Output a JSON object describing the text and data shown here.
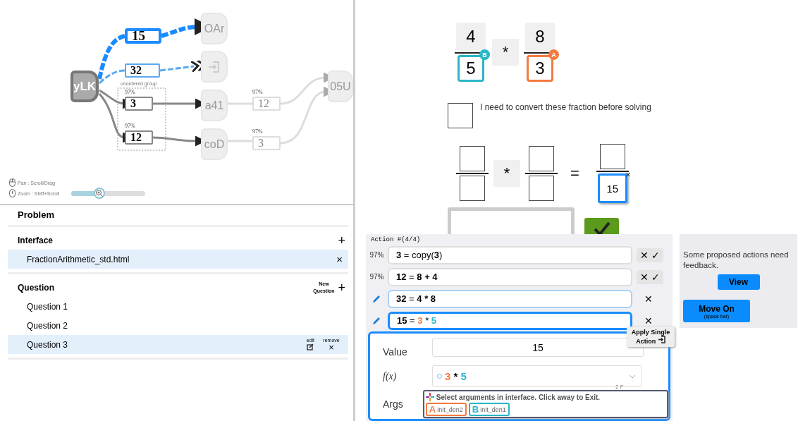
{
  "graph": {
    "nodes": [
      {
        "label": "yLK",
        "kind": "source"
      },
      {
        "label": "OAr",
        "kind": "faded"
      },
      {
        "kind": "icon"
      },
      {
        "label": "a41",
        "kind": "faded"
      },
      {
        "label": "coD",
        "kind": "faded"
      },
      {
        "label": "05U",
        "kind": "faded"
      }
    ],
    "values": [
      {
        "value": "15",
        "selected": true,
        "proposed": true,
        "faded": false
      },
      {
        "value": "32",
        "selected": false,
        "proposed": true,
        "faded": false
      },
      {
        "value": "3",
        "confidence": "97%",
        "selected": false,
        "proposed": false,
        "faded": false
      },
      {
        "value": "12",
        "confidence": "97%",
        "selected": false,
        "proposed": false,
        "faded": false
      },
      {
        "value": "12",
        "confidence": "97%",
        "selected": false,
        "proposed": false,
        "faded": true
      },
      {
        "value": "3",
        "confidence": "97%",
        "selected": false,
        "proposed": false,
        "faded": true
      }
    ],
    "group_label": "unordered group",
    "pan_hint": "Pan : Scroll/Drag",
    "zoom_hint": "Zoom : Shift+Scroll",
    "zoom": {
      "level": 0.38
    }
  },
  "problem": {
    "title": "Problem",
    "interface": {
      "title": "Interface",
      "add": "+",
      "items": [
        {
          "label": "FractionArithmetic_std.html",
          "selected": true,
          "remove": "×"
        }
      ]
    },
    "question": {
      "title": "Question",
      "new_label": "New Question",
      "add": "+",
      "items": [
        {
          "label": "Question 1",
          "selected": false
        },
        {
          "label": "Question 2",
          "selected": false
        },
        {
          "label": "Question 3",
          "selected": true,
          "edit": "edit",
          "remove": "remove",
          "remove_icon": "×"
        }
      ]
    }
  },
  "interface": {
    "fractions": [
      {
        "numerator": "4",
        "denominator": "5",
        "badge": "B",
        "color": "#2bb5c8"
      },
      {
        "numerator": "8",
        "denominator": "3",
        "badge": "A",
        "color": "#f47b3f"
      }
    ],
    "operator": "*",
    "checkbox": {
      "label": "I need to convert these fraction before solving",
      "checked": false
    },
    "answer": {
      "operator": "*",
      "equals": "=",
      "result_denominator": "15",
      "close": "×"
    }
  },
  "actions": {
    "title": "Action #(4/4)",
    "items": [
      {
        "kind": "proposed",
        "confidence": "97%",
        "value": "3",
        "equals": "=",
        "parts": [
          {
            "text": "copy(**3**)"
          }
        ],
        "reject": "✕",
        "accept": "✓"
      },
      {
        "kind": "proposed",
        "confidence": "97%",
        "value": "12",
        "equals": "=",
        "parts": [
          {
            "text": "**8 + 4**"
          }
        ],
        "reject": "✕",
        "accept": "✓"
      },
      {
        "kind": "edited",
        "value": "32",
        "equals": "=",
        "selected": false,
        "parts": [
          {
            "text": "**4 * 8**"
          }
        ],
        "remove": "✕"
      },
      {
        "kind": "edited",
        "value": "15",
        "equals": "=",
        "selected": true,
        "parts": [
          {
            "text": "**3**",
            "color": "#f47b3f"
          },
          {
            "text": " * "
          },
          {
            "text": "**5**",
            "color": "#2bb5c8"
          }
        ],
        "remove": "✕"
      }
    ],
    "tooltip": "Apply Single Action",
    "editor": {
      "value_label": "Value",
      "value": "15",
      "fx_label": "f(x)",
      "fx_parts": [
        {
          "text": "3",
          "color": "#f47b3f"
        },
        {
          "text": " * "
        },
        {
          "text": "5",
          "color": "#2bb5c8"
        }
      ],
      "fx_note": "2 F",
      "args_label": "Args",
      "args_hint": "Select arguments in interface. Click away to Exit.",
      "args": [
        {
          "letter": "A",
          "name": "init_den2",
          "color": "#f47b3f"
        },
        {
          "letter": "B",
          "name": "init_den1",
          "color": "#2bb5c8"
        }
      ]
    }
  },
  "feedback": {
    "message": "Some proposed actions need feedback.",
    "view": "View",
    "move_on": "Move On",
    "move_on_hint": "(space bar)"
  }
}
